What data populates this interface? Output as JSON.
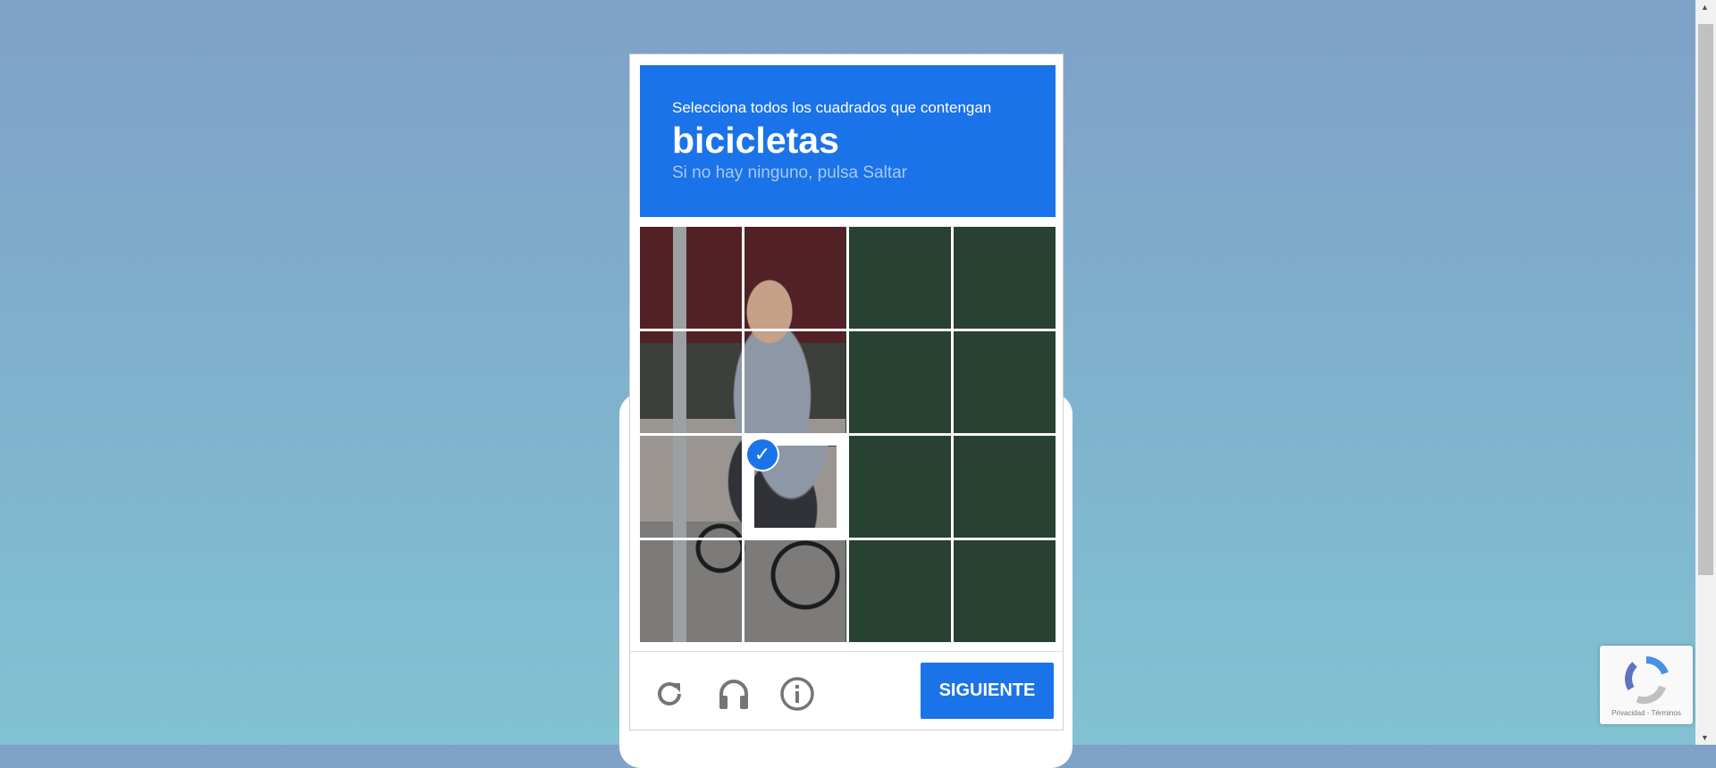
{
  "challenge": {
    "instruction": "Selecciona todos los cuadrados que contengan",
    "target": "bicicletas",
    "hint": "Si no hay ninguno, pulsa Saltar"
  },
  "grid": {
    "rows": 4,
    "columns": 4,
    "selected_tiles": [
      9
    ]
  },
  "footer": {
    "reload_icon": "reload-icon",
    "audio_icon": "headphones-icon",
    "info_icon": "info-icon",
    "next_label": "SIGUIENTE"
  },
  "recaptcha_badge": {
    "text": "Privacidad - Términos"
  },
  "colors": {
    "accent": "#1a73e8",
    "hint": "#a9c8f5"
  }
}
